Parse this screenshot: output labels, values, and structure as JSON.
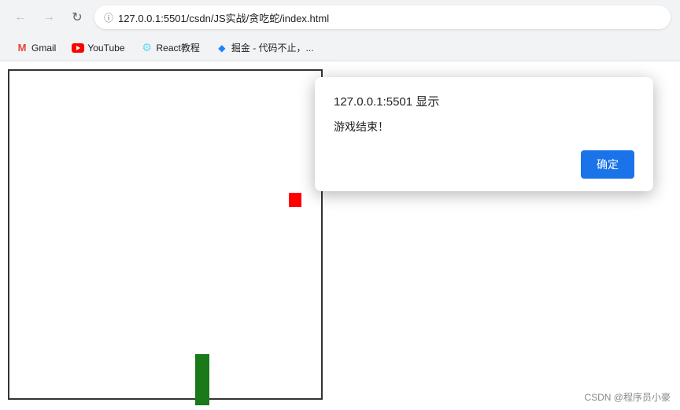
{
  "browser": {
    "address": "127.0.0.1:5501/csdn/JS实战/贪吃蛇/index.html",
    "back_btn": "←",
    "forward_btn": "→",
    "reload_btn": "↻"
  },
  "bookmarks": [
    {
      "id": "gmail",
      "label": "Gmail",
      "icon_type": "gmail"
    },
    {
      "id": "youtube",
      "label": "YouTube",
      "icon_type": "youtube"
    },
    {
      "id": "react",
      "label": "React教程",
      "icon_type": "react"
    },
    {
      "id": "juejin",
      "label": "掘金 - 代码不止，...",
      "icon_type": "juejin"
    }
  ],
  "alert": {
    "title": "127.0.0.1:5501 显示",
    "message": "游戏结束！",
    "ok_label": "确定"
  },
  "watermark": "CSDN @程序员小豪"
}
